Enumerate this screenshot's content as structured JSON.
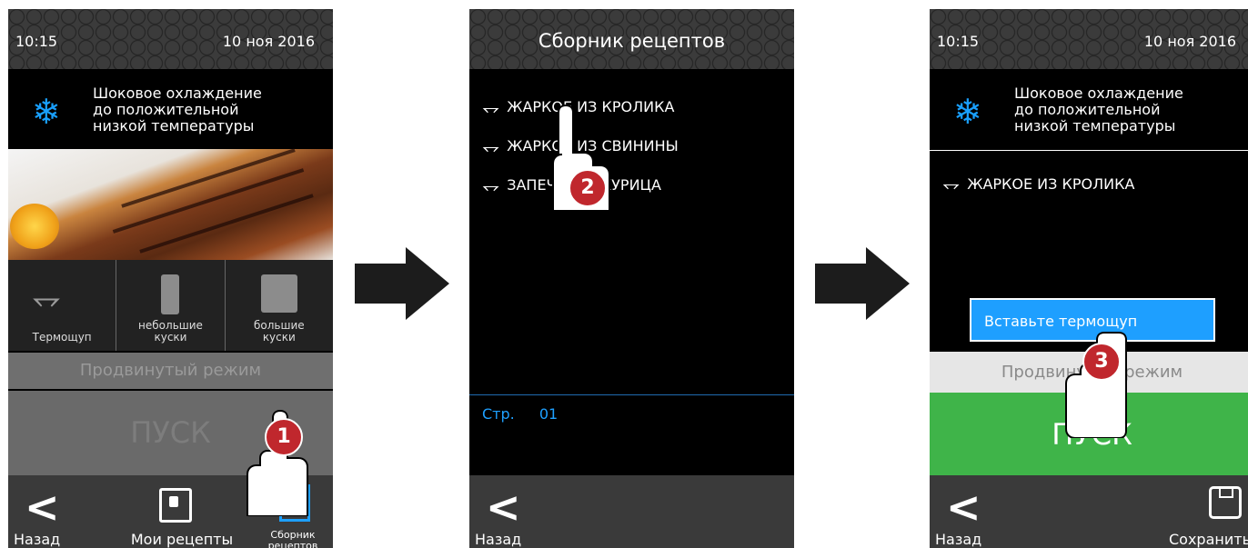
{
  "screen1": {
    "time": "10:15",
    "date": "10 ноя 2016",
    "mode_lines": [
      "Шоковое охлаждение",
      "до положительной",
      "низкой температуры"
    ],
    "options": [
      {
        "label_lines": [
          "Термощуп"
        ],
        "icon": "probe-icon"
      },
      {
        "label_lines": [
          "небольшие",
          "куски"
        ],
        "icon": "small-pieces-icon"
      },
      {
        "label_lines": [
          "большие",
          "куски"
        ],
        "icon": "large-pieces-icon"
      }
    ],
    "advanced_label": "Продвинутый режим",
    "start_label": "ПУСК",
    "nav": {
      "back": "Назад",
      "my_recipes": "Мои рецепты",
      "recipe_book_lines": [
        "Сборник",
        "рецептов"
      ]
    }
  },
  "screen2": {
    "title": "Сборник рецептов",
    "recipes": [
      "ЖАРКОЕ ИЗ КРОЛИКА",
      "ЖАРКОЕ ИЗ СВИНИНЫ",
      "ЗАПЕЧЕНАЯ КУРИЦА"
    ],
    "page_label": "Стр.",
    "page_number": "01",
    "nav": {
      "back": "Назад"
    }
  },
  "screen3": {
    "time": "10:15",
    "date": "10 ноя 2016",
    "mode_lines": [
      "Шоковое охлаждение",
      "до положительной",
      "низкой температуры"
    ],
    "selected_recipe": "ЖАРКОЕ ИЗ КРОЛИКА",
    "tooltip": "Вставьте термощуп",
    "advanced_label": "Продвинутый режим",
    "start_label": "ПУСК",
    "nav": {
      "back": "Назад",
      "save": "Сохранить"
    }
  },
  "steps": [
    "1",
    "2",
    "3"
  ],
  "colors": {
    "accent_blue": "#1e9fff",
    "start_green": "#3fb449",
    "badge_red": "#c0272d"
  }
}
